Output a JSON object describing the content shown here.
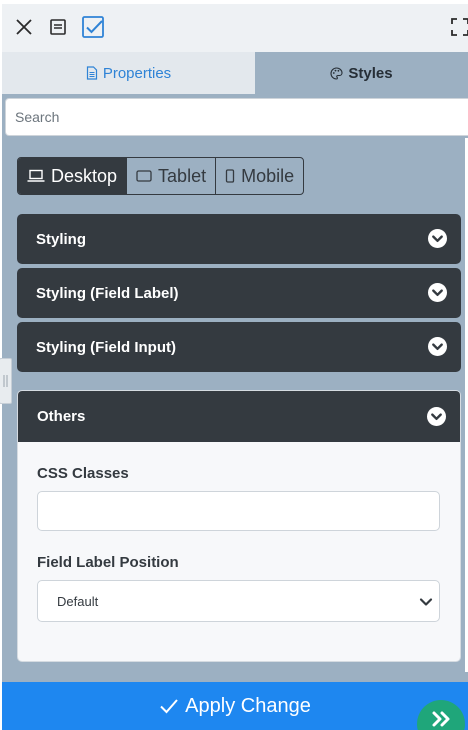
{
  "toolbar": {
    "close_icon": "close-icon",
    "list_icon": "list-icon",
    "check_icon": "checkbox-checked-icon",
    "fullscreen_icon": "fullscreen-icon",
    "accent_color": "#2f83d6"
  },
  "tabs": [
    {
      "label": "Properties",
      "icon": "document-icon",
      "active": false
    },
    {
      "label": "Styles",
      "icon": "palette-icon",
      "active": true
    }
  ],
  "search": {
    "placeholder": "Search",
    "value": ""
  },
  "devices": [
    {
      "label": "Desktop",
      "icon": "laptop-icon",
      "active": true
    },
    {
      "label": "Tablet",
      "icon": "tablet-icon",
      "active": false
    },
    {
      "label": "Mobile",
      "icon": "mobile-icon",
      "active": false
    }
  ],
  "sections": [
    {
      "title": "Styling",
      "expanded": false
    },
    {
      "title": "Styling (Field Label)",
      "expanded": false
    },
    {
      "title": "Styling (Field Input)",
      "expanded": false
    },
    {
      "title": "Others",
      "expanded": true
    }
  ],
  "others": {
    "css_classes_label": "CSS Classes",
    "css_classes_value": "",
    "field_label_position_label": "Field Label Position",
    "field_label_position_value": "Default"
  },
  "footer": {
    "apply_label": "Apply Change",
    "apply_color": "#1e87f0",
    "fab_color": "#1fa67a",
    "fab_icon": "double-chevron-right-icon"
  }
}
